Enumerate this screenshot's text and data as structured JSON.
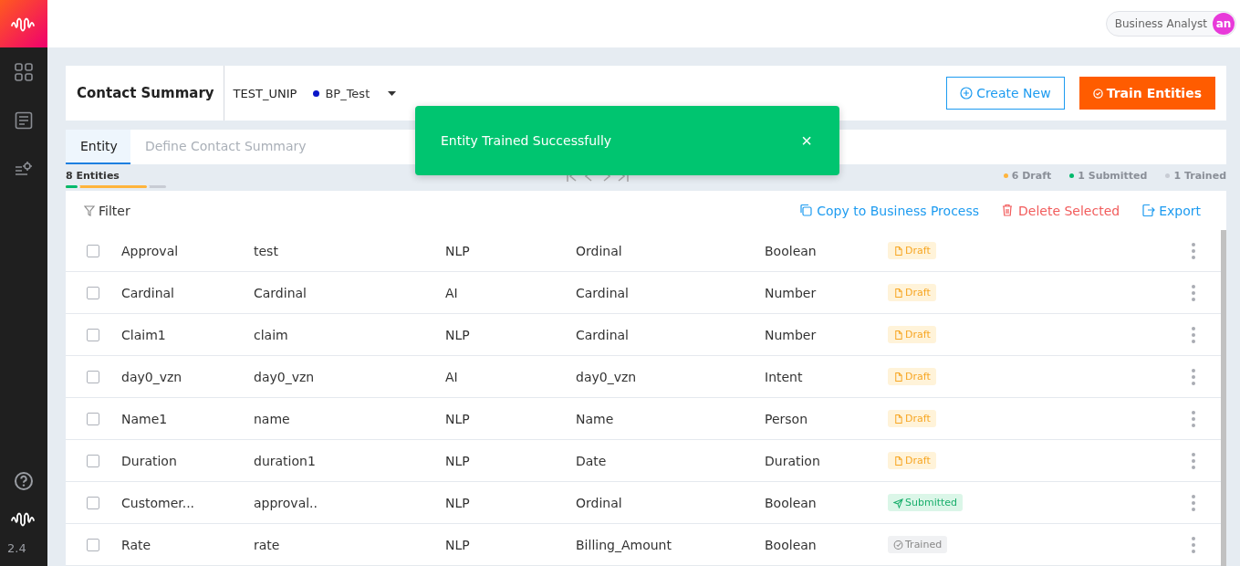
{
  "sidebar": {
    "items": [
      {
        "kind": "grid"
      },
      {
        "kind": "document"
      },
      {
        "kind": "settings-list"
      }
    ],
    "footer": {
      "version": "2.4"
    }
  },
  "user": {
    "role": "Business Analyst",
    "initials": "an"
  },
  "header": {
    "title": "Contact Summary",
    "project": "TEST_UNIP",
    "process": {
      "label": "BP_Test",
      "color": "#0a16c8"
    },
    "buttons": [
      {
        "label": "Create New",
        "kind": "outline"
      },
      {
        "label": "Train Entities",
        "kind": "primary"
      }
    ]
  },
  "tabs": [
    {
      "label": "Entity",
      "selected": true
    },
    {
      "label": "Define Contact Summary",
      "selected": false
    }
  ],
  "summary": {
    "count": "8 Entities",
    "segments": [
      {
        "color": "#00b96b",
        "level": 0.12
      },
      {
        "color": "#ffb43c",
        "level": 0.81
      }
    ],
    "legend": [
      {
        "label": "6 Draft",
        "color": "#ffb43c"
      },
      {
        "label": "1 Submitted",
        "color": "#00b96b"
      },
      {
        "label": "1 Trained",
        "color": "#c8ccd4"
      }
    ]
  },
  "toolbar": {
    "filter": "Filter",
    "actions": [
      {
        "label": "Copy to Business Process",
        "kind": "copy"
      },
      {
        "label": "Delete Selected",
        "kind": "delete"
      },
      {
        "label": "Export",
        "kind": "export"
      }
    ]
  },
  "table": {
    "rows": [
      {
        "checked": false,
        "cells": [
          "Approval",
          "test",
          "NLP",
          "Ordinal",
          "Boolean"
        ],
        "status": {
          "label": "Draft",
          "kind": "draft"
        }
      },
      {
        "checked": false,
        "cells": [
          "Cardinal",
          "Cardinal",
          "AI",
          "Cardinal",
          "Number"
        ],
        "status": {
          "label": "Draft",
          "kind": "draft"
        }
      },
      {
        "checked": false,
        "cells": [
          "Claim1",
          "claim",
          "NLP",
          "Cardinal",
          "Number"
        ],
        "status": {
          "label": "Draft",
          "kind": "draft"
        }
      },
      {
        "checked": false,
        "cells": [
          "day0_vzn",
          "day0_vzn",
          "AI",
          "day0_vzn",
          "Intent"
        ],
        "status": {
          "label": "Draft",
          "kind": "draft"
        }
      },
      {
        "checked": false,
        "cells": [
          "Name1",
          "name",
          "NLP",
          "Name",
          "Person"
        ],
        "status": {
          "label": "Draft",
          "kind": "draft"
        }
      },
      {
        "checked": false,
        "cells": [
          "Duration",
          "duration1",
          "NLP",
          "Date",
          "Duration"
        ],
        "status": {
          "label": "Draft",
          "kind": "draft"
        }
      },
      {
        "checked": false,
        "cells": [
          "Customer...",
          "approval..",
          "NLP",
          "Ordinal",
          "Boolean"
        ],
        "status": {
          "label": "Submitted",
          "kind": "submitted"
        }
      },
      {
        "checked": false,
        "cells": [
          "Rate",
          "rate",
          "NLP",
          "Billing_Amount",
          "Boolean"
        ],
        "status": {
          "label": "Trained",
          "kind": "trained"
        }
      }
    ]
  },
  "toast": {
    "message": "Entity Trained Successfully",
    "close": "×"
  }
}
